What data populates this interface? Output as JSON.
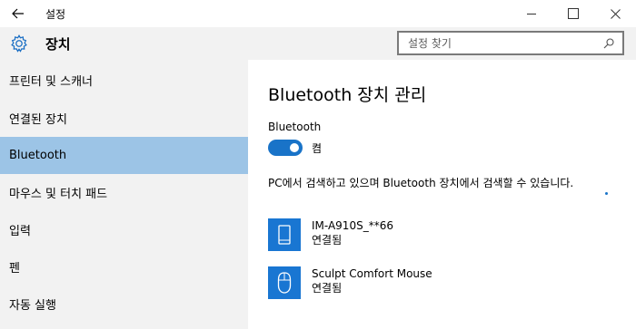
{
  "titlebar": {
    "back_icon": "arrow-left-icon",
    "app_title": "설정"
  },
  "header": {
    "icon": "gear-icon",
    "title": "장치",
    "search_placeholder": "설정 찾기"
  },
  "sidebar": {
    "items": [
      {
        "label": "프린터 및 스캐너",
        "active": false
      },
      {
        "label": "연결된 장치",
        "active": false
      },
      {
        "label": "Bluetooth",
        "active": true
      },
      {
        "label": "마우스 및 터치 패드",
        "active": false
      },
      {
        "label": "입력",
        "active": false
      },
      {
        "label": "펜",
        "active": false
      },
      {
        "label": "자동 실행",
        "active": false
      }
    ]
  },
  "main": {
    "title": "Bluetooth 장치 관리",
    "bluetooth_label": "Bluetooth",
    "toggle_state": "켬",
    "description": "PC에서 검색하고 있으며 Bluetooth 장치에서 검색할 수 있습니다.",
    "devices": [
      {
        "name": "IM-A910S_**66",
        "status": "연결됨",
        "icon": "phone-icon"
      },
      {
        "name": "Sculpt Comfort Mouse",
        "status": "연결됨",
        "icon": "mouse-icon"
      }
    ]
  },
  "colors": {
    "accent": "#1976d2",
    "toggle_on": "#1973c8",
    "sidebar_active": "#9cc4e6",
    "sidebar_bg": "#f2f2f2"
  }
}
